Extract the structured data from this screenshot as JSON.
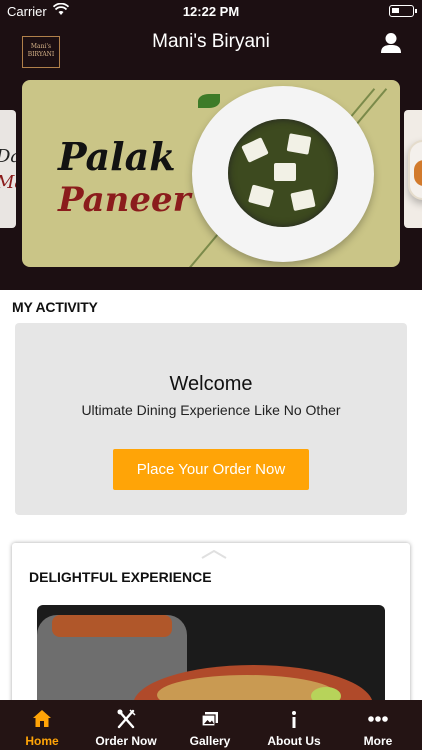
{
  "status_bar": {
    "carrier": "Carrier",
    "time": "12:22 PM"
  },
  "header": {
    "title": "Mani's Biryani",
    "logo_text_1": "Mani's",
    "logo_text_2": "BIRYANI"
  },
  "banner": {
    "line1": "Palak",
    "line2": "Paneer",
    "left_peek_1": "Da",
    "left_peek_2": "Ma"
  },
  "activity": {
    "heading": "MY ACTIVITY",
    "welcome": "Welcome",
    "subtitle": "Ultimate Dining Experience Like No Other",
    "order_button": "Place Your Order Now"
  },
  "experience": {
    "heading": "DELIGHTFUL EXPERIENCE"
  },
  "tabs": [
    {
      "label": "Home",
      "icon": "home-icon",
      "active": true
    },
    {
      "label": "Order Now",
      "icon": "utensils-icon",
      "active": false
    },
    {
      "label": "Gallery",
      "icon": "gallery-icon",
      "active": false
    },
    {
      "label": "About Us",
      "icon": "info-icon",
      "active": false
    },
    {
      "label": "More",
      "icon": "more-dots-icon",
      "active": false
    }
  ],
  "colors": {
    "accent": "#ffa407",
    "header_bg": "#1c0f12",
    "tabbar_bg": "#241414",
    "banner_bg": "#cac587"
  }
}
